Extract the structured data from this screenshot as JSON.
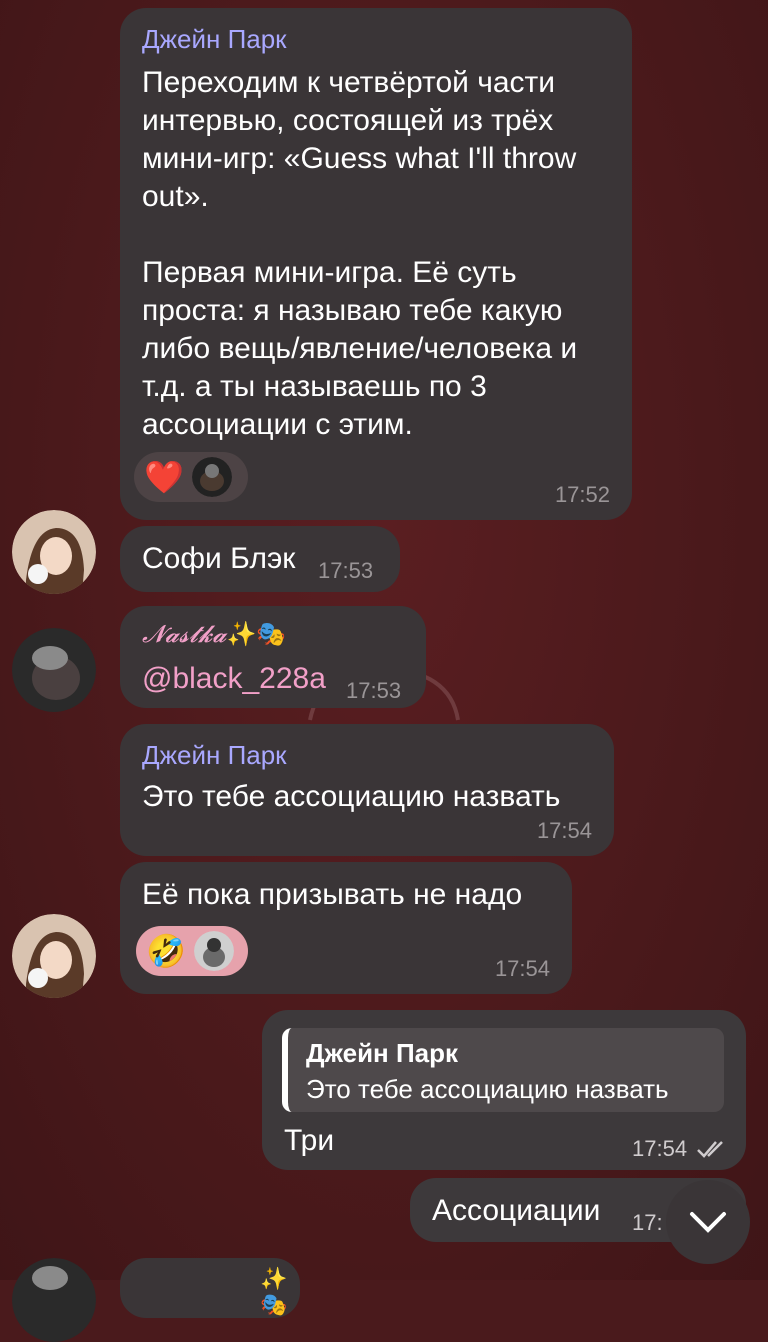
{
  "messages": [
    {
      "sender": "Джейн Парк",
      "text": "Переходим к четвёртой части интервью, состоящей из трёх мини-игр: «Guess what I'll throw out».\n\nПервая мини-игра. Её суть проста: я называю тебе какую либо вещь/явление/человека и т.д. а ты называешь по 3 ассоциации с этим.",
      "time": "17:52",
      "reactions": [
        "heart-emoji"
      ]
    },
    {
      "text": "Софи Блэк",
      "time": "17:53"
    },
    {
      "sender": "𝓝𝓪𝓼𝓽𝓴𝓪",
      "sender_emoji": "✨🎭",
      "text": "@black_228a",
      "time": "17:53"
    },
    {
      "sender": "Джейн Парк",
      "text": "Это тебе ассоциацию назвать",
      "time": "17:54"
    },
    {
      "text": "Её пока призывать не надо",
      "time": "17:54",
      "reactions": [
        "rofl-emoji"
      ]
    },
    {
      "quote_sender": "Джейн Парк",
      "quote_text": "Это тебе ассоциацию назвать",
      "text": "Три",
      "time": "17:54"
    },
    {
      "text": "Ассоциации",
      "time": "17:"
    }
  ],
  "partial": {
    "sender_emoji": "✨🎭"
  },
  "icons": {
    "heart": "❤️",
    "rofl": "🤣",
    "check": "double-check-icon",
    "scroll": "chevron-down-icon"
  },
  "colors": {
    "background": "#4a1a1c",
    "bubble": "#3a3537",
    "sender": "#a9a8ff",
    "time": "#9a9597",
    "reaction_active": "#e6a2ac"
  }
}
